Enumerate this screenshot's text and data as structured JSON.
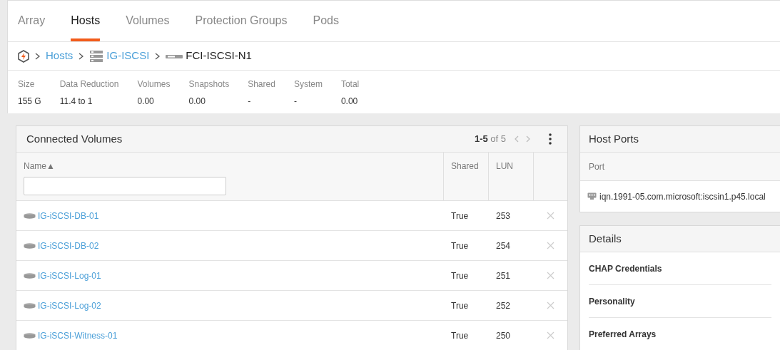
{
  "tabs": [
    {
      "label": "Array",
      "selected": false
    },
    {
      "label": "Hosts",
      "selected": true
    },
    {
      "label": "Volumes",
      "selected": false
    },
    {
      "label": "Protection Groups",
      "selected": false
    },
    {
      "label": "Pods",
      "selected": false
    }
  ],
  "breadcrumb": [
    {
      "kind": "home"
    },
    {
      "kind": "link",
      "label": "Hosts"
    },
    {
      "kind": "hostgroup",
      "label": "IG-ISCSI"
    },
    {
      "kind": "host",
      "label": "FCI-ISCSI-N1"
    }
  ],
  "stats": [
    {
      "label": "Size",
      "value": "155 G"
    },
    {
      "label": "Data Reduction",
      "value": "11.4 to 1"
    },
    {
      "label": "Volumes",
      "value": "0.00"
    },
    {
      "label": "Snapshots",
      "value": "0.00"
    },
    {
      "label": "Shared",
      "value": "-"
    },
    {
      "label": "System",
      "value": "-"
    },
    {
      "label": "Total",
      "value": "0.00"
    }
  ],
  "connected_volumes": {
    "title": "Connected Volumes",
    "pager": "**1-5** of 5",
    "prev_disabled": true,
    "next_disabled": true,
    "columns": [
      "Name▲",
      "Shared",
      "LUN"
    ],
    "rows": [
      {
        "name": "IG-iSCSI-DB-01",
        "shared": "True",
        "lun": "253"
      },
      {
        "name": "IG-iSCSI-DB-02",
        "shared": "True",
        "lun": "254"
      },
      {
        "name": "IG-iSCSI-Log-01",
        "shared": "True",
        "lun": "251"
      },
      {
        "name": "IG-iSCSI-Log-02",
        "shared": "True",
        "lun": "252"
      },
      {
        "name": "IG-iSCSI-Witness-01",
        "shared": "True",
        "lun": "250"
      }
    ]
  },
  "host_ports": {
    "title": "Host Ports",
    "column": "Port",
    "ports": [
      "iqn.1991-05.com.microsoft:iscsin1.p45.local"
    ]
  },
  "details": {
    "title": "Details",
    "items": [
      "CHAP Credentials",
      "Personality",
      "Preferred Arrays"
    ]
  }
}
